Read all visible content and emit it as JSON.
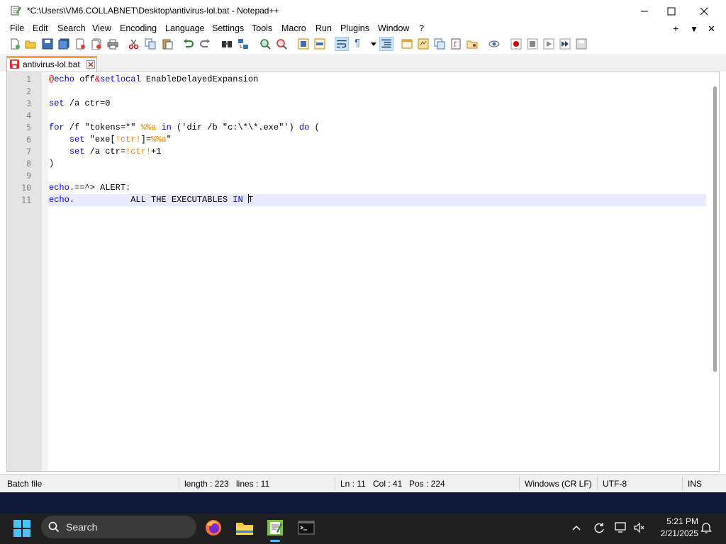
{
  "window": {
    "title": "*C:\\Users\\VM6.COLLABNET\\Desktop\\antivirus-lol.bat - Notepad++"
  },
  "menu": {
    "items": [
      "File",
      "Edit",
      "Search",
      "View",
      "Encoding",
      "Language",
      "Settings",
      "Tools",
      "Macro",
      "Run",
      "Plugins",
      "Window",
      "?"
    ],
    "right": [
      "+",
      "▼",
      "✕"
    ]
  },
  "tab": {
    "label": "antivirus-lol.bat"
  },
  "editor": {
    "line_numbers": [
      "1",
      "2",
      "3",
      "4",
      "5",
      "6",
      "7",
      "8",
      "9",
      "10",
      "11"
    ],
    "current_line": 11,
    "lines": [
      "@echo off&setlocal EnableDelayedExpansion",
      "",
      "set /a ctr=0",
      "",
      "for /f \"tokens=*\" %%a in ('dir /b \"c:\\*\\*.exe\"') do (",
      "    set \"exe[!ctr!]=%%a\"",
      "    set /a ctr=!ctr!+1",
      ")",
      "",
      "echo.==^> ALERT:",
      "echo.           ALL THE EXECUTABLES IN T"
    ]
  },
  "statusbar": {
    "filetype": "Batch file",
    "length": "length : 223",
    "lines": "lines : 11",
    "ln": "Ln : 11",
    "col": "Col : 41",
    "pos": "Pos : 224",
    "eol": "Windows (CR LF)",
    "encoding": "UTF-8",
    "mode": "INS"
  },
  "taskbar": {
    "search_label": "Search",
    "time": "5:21 PM",
    "date": "2/21/2025"
  },
  "colors": {
    "keyword": "#0000ff",
    "operator": "#ff0000",
    "variable": "#ff8000",
    "tab_accent": "#f7a435",
    "current_line": "#e8e8ff",
    "taskbar": "#202020"
  }
}
